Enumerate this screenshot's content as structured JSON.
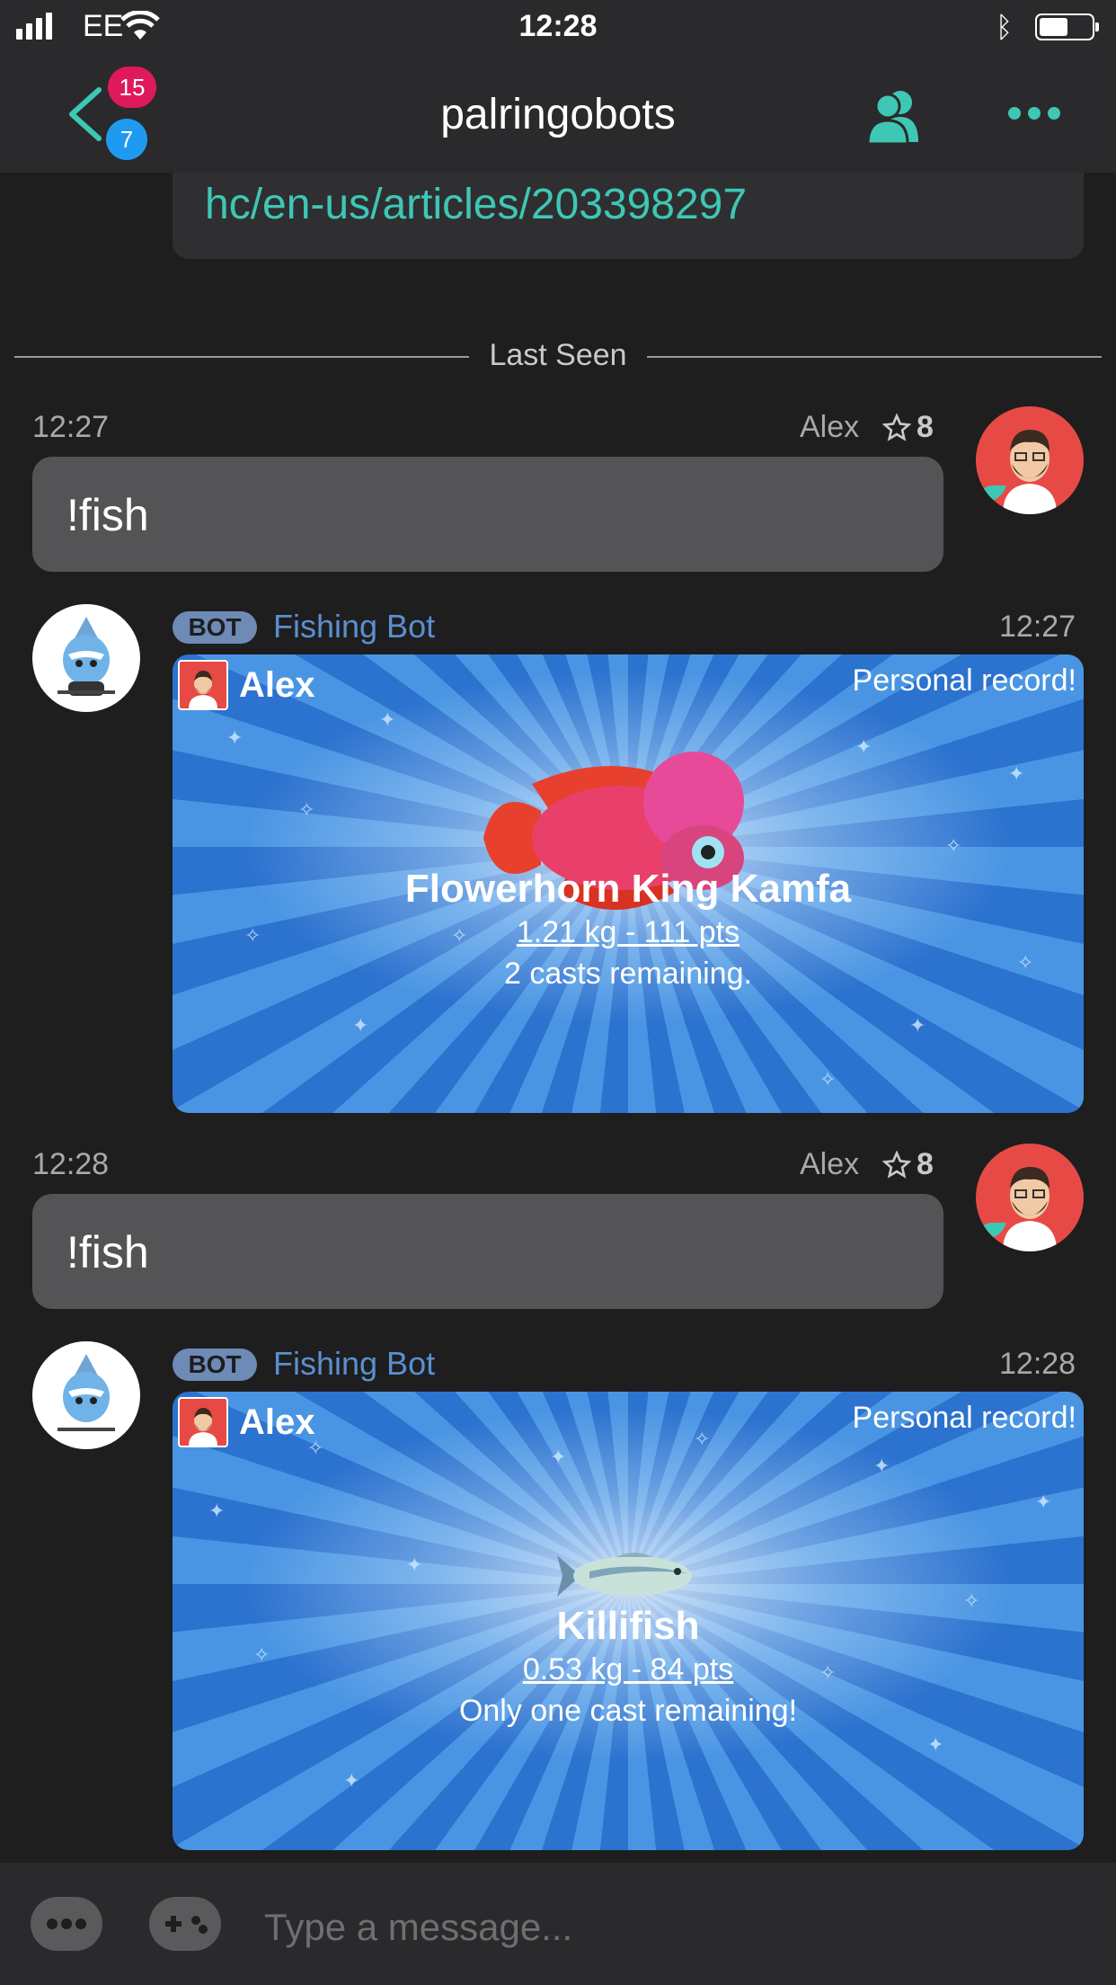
{
  "status_bar": {
    "carrier": "EE",
    "time": "12:28",
    "battery_level": 0.55
  },
  "nav": {
    "title": "palringobots",
    "badge_pink": "15",
    "badge_blue": "7",
    "accent_color": "#3ec7b5"
  },
  "messages": {
    "link_text": "hc/en-us/articles/203398297",
    "divider_label": "Last Seen",
    "user_msg_1": {
      "time": "12:27",
      "author": "Alex",
      "stars": "8",
      "text": "!fish"
    },
    "bot_msg_1": {
      "tag": "BOT",
      "name": "Fishing Bot",
      "time": "12:27",
      "card_user": "Alex",
      "card_record": "Personal record!",
      "fish_name": "Flowerhorn King Kamfa",
      "fish_weight": "1.21 kg - 111 pts",
      "casts": "2 casts remaining."
    },
    "user_msg_2": {
      "time": "12:28",
      "author": "Alex",
      "stars": "8",
      "text": "!fish"
    },
    "bot_msg_2": {
      "tag": "BOT",
      "name": "Fishing Bot",
      "time": "12:28",
      "card_user": "Alex",
      "card_record": "Personal record!",
      "fish_name": "Killifish",
      "fish_weight": "0.53 kg - 84 pts",
      "casts": "Only one cast remaining!"
    }
  },
  "input": {
    "placeholder": "Type a message..."
  }
}
